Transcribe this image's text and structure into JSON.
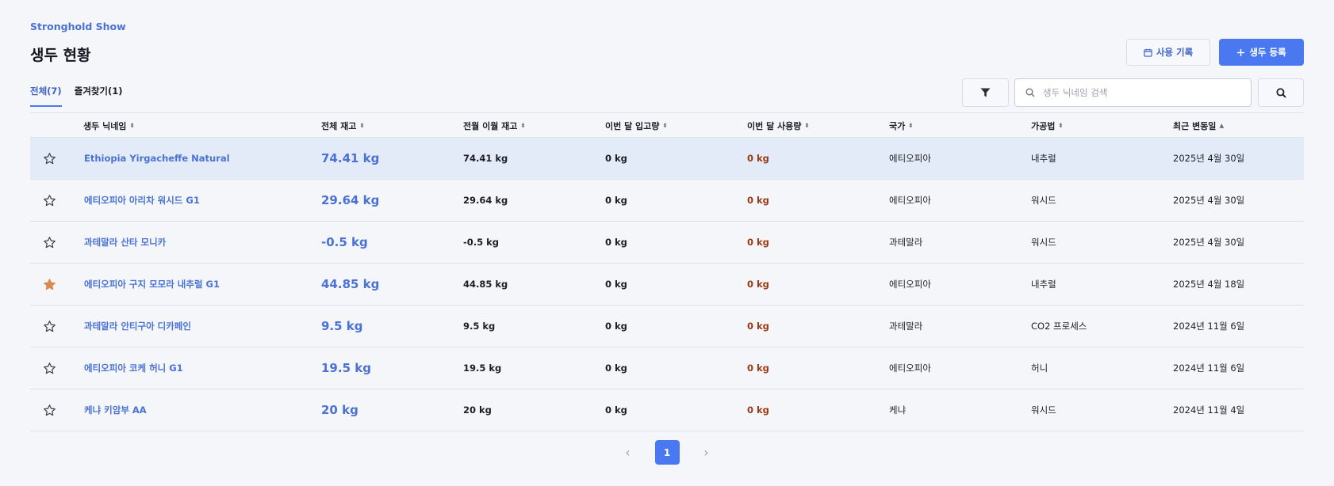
{
  "brand": "Stronghold Show",
  "page_title": "생두 현황",
  "actions": {
    "history_label": "사용 기록",
    "register_label": "생두 등록"
  },
  "tabs": [
    {
      "label": "전체(7)"
    },
    {
      "label": "즐겨찾기(1)"
    }
  ],
  "search": {
    "placeholder": "생두 닉네임 검색",
    "value": ""
  },
  "columns": [
    {
      "label": "생두 닉네임",
      "sort": "⬍"
    },
    {
      "label": "전체 재고",
      "sort": "⬍"
    },
    {
      "label": "전월 이월 재고",
      "sort": "⬍"
    },
    {
      "label": "이번 달 입고량",
      "sort": "⬍"
    },
    {
      "label": "이번 달 사용량",
      "sort": "⬍"
    },
    {
      "label": "국가",
      "sort": "⬍"
    },
    {
      "label": "가공법",
      "sort": "⬍"
    },
    {
      "label": "최근 변동일",
      "sort": "▲"
    }
  ],
  "rows": [
    {
      "favorite": false,
      "name": "Ethiopia Yirgacheffe Natural",
      "total": "74.41 kg",
      "prev": "74.41 kg",
      "incoming": "0 kg",
      "usage": "0 kg",
      "country": "에티오피아",
      "process": "내추럴",
      "date": "2025년 4월 30일"
    },
    {
      "favorite": false,
      "name": "에티오피아 아리차 워시드 G1",
      "total": "29.64 kg",
      "prev": "29.64 kg",
      "incoming": "0 kg",
      "usage": "0 kg",
      "country": "에티오피아",
      "process": "워시드",
      "date": "2025년 4월 30일"
    },
    {
      "favorite": false,
      "name": "과테말라 산타 모니카",
      "total": "-0.5 kg",
      "prev": "-0.5 kg",
      "incoming": "0 kg",
      "usage": "0 kg",
      "country": "과테말라",
      "process": "워시드",
      "date": "2025년 4월 30일"
    },
    {
      "favorite": true,
      "name": "에티오피아 구지 모모라 내추럴 G1",
      "total": "44.85 kg",
      "prev": "44.85 kg",
      "incoming": "0 kg",
      "usage": "0 kg",
      "country": "에티오피아",
      "process": "내추럴",
      "date": "2025년 4월 18일"
    },
    {
      "favorite": false,
      "name": "과테말라 안티구아 디카페인",
      "total": "9.5 kg",
      "prev": "9.5 kg",
      "incoming": "0 kg",
      "usage": "0 kg",
      "country": "과테말라",
      "process": "CO2 프로세스",
      "date": "2024년 11월 6일"
    },
    {
      "favorite": false,
      "name": "에티오피아 코케 허니 G1",
      "total": "19.5 kg",
      "prev": "19.5 kg",
      "incoming": "0 kg",
      "usage": "0 kg",
      "country": "에티오피아",
      "process": "허니",
      "date": "2024년 11월 6일"
    },
    {
      "favorite": false,
      "name": "케냐 키암부 AA",
      "total": "20 kg",
      "prev": "20 kg",
      "incoming": "0 kg",
      "usage": "0 kg",
      "country": "케냐",
      "process": "워시드",
      "date": "2024년 11월 4일"
    }
  ],
  "pagination": {
    "current": "1"
  },
  "colors": {
    "accent": "#4a78f0",
    "link": "#4a72d4",
    "usage": "#9b3a12",
    "star_active": "#d98a4e",
    "selected_row": "#e4ebf8"
  },
  "icons": {
    "history": "calendar-icon",
    "register": "plus-icon",
    "filter": "filter-icon",
    "search": "search-icon",
    "favorite": "star-icon"
  }
}
